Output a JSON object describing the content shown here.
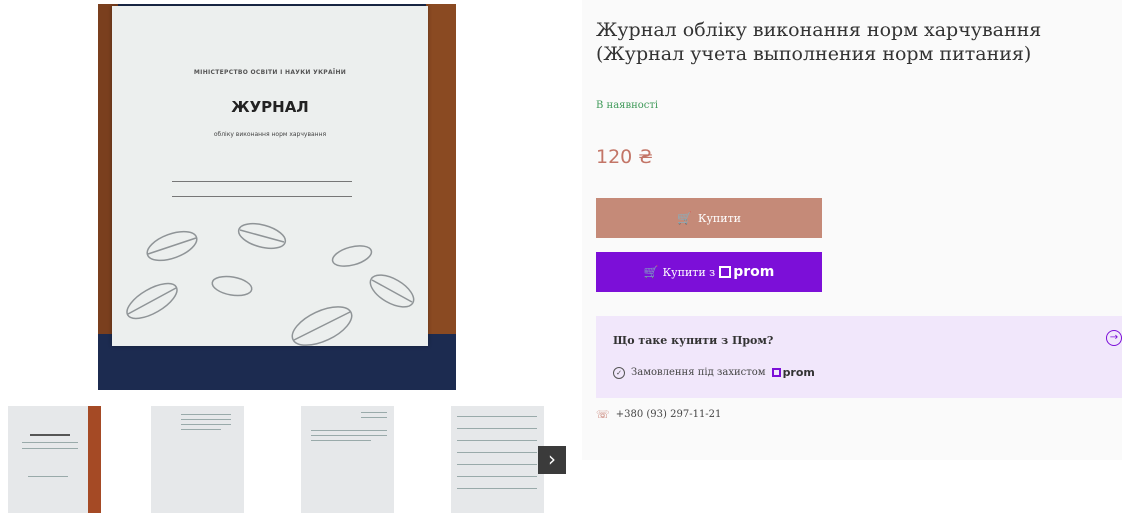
{
  "gallery": {
    "cover": {
      "ministry": "МІНІСТЕРСТВО ОСВІТИ І НАУКИ УКРАЇНИ",
      "title": "ЖУРНАЛ",
      "subtitle": "обліку виконання норм харчування"
    },
    "next_icon": "chevron-right-icon"
  },
  "product": {
    "title": "Журнал обліку виконання норм харчування (Журнал учета выполнения норм питания)",
    "availability": "В наявності",
    "price": "120 ₴",
    "buy_label": "Купити",
    "buy_prom_label": "Купити з",
    "prom_logo": "prom"
  },
  "prom_info": {
    "question": "Що таке купити з Пром?",
    "guarantee": "Замовлення під захистом",
    "logo": "prom"
  },
  "contacts": {
    "phone": "+380 (93) 297-11-21"
  },
  "colors": {
    "price": "#c37567",
    "buy_button": "#c58a78",
    "prom_button": "#7c0fd8",
    "prom_box_bg": "#f1e7fb",
    "availability": "#3f9a59"
  }
}
